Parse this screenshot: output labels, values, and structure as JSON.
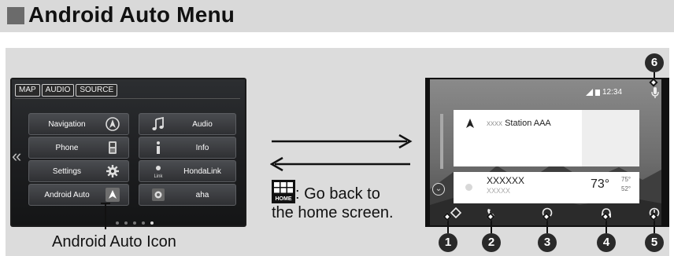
{
  "title": "Android Auto Menu",
  "head_unit": {
    "tabs": [
      "MAP",
      "AUDIO",
      "SOURCE"
    ],
    "left_items": [
      "Navigation",
      "Phone",
      "Settings",
      "Android Auto"
    ],
    "right_items": [
      "Audio",
      "Info",
      "HondaLink",
      "aha"
    ],
    "icon_texts": {
      "hondalink": "Link"
    }
  },
  "callout": "Android Auto Icon",
  "note": {
    "badge": "HOME",
    "text_line1": ": Go back to",
    "text_line2": "the home screen."
  },
  "android_auto": {
    "clock": "12:34",
    "station_prefix": "xxxx",
    "station": "Station AAA",
    "weather_title": "XXXXXX",
    "weather_sub": "XXXXX",
    "temp": "73°",
    "temp_high": "75°",
    "temp_low": "52°"
  },
  "callout_numbers": [
    "1",
    "2",
    "3",
    "4",
    "5",
    "6"
  ]
}
